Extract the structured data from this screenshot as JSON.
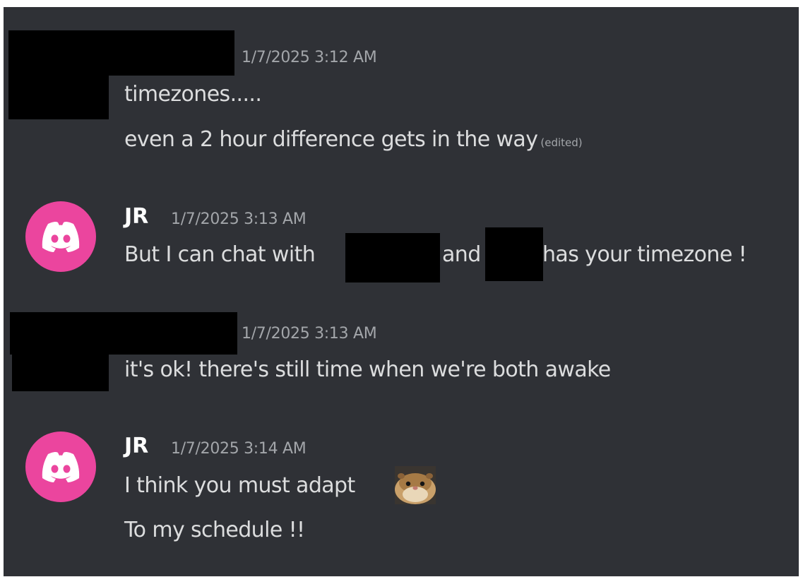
{
  "messages": [
    {
      "author": "",
      "timestamp": "1/7/2025 3:12 AM",
      "lines": [
        "timezones.....",
        "even a 2 hour difference gets in the way"
      ],
      "edited_label": "(edited)"
    },
    {
      "author": "JR",
      "timestamp": "1/7/2025 3:13 AM",
      "avatar_icon": "discord-logo-icon",
      "avatar_color": "#eb459e",
      "parts": [
        "But I can chat with",
        "and",
        "has your timezone !"
      ]
    },
    {
      "author": "",
      "timestamp": "1/7/2025 3:13 AM",
      "lines": [
        "it's ok! there's still time when we're both awake"
      ]
    },
    {
      "author": "JR",
      "timestamp": "1/7/2025 3:14 AM",
      "avatar_icon": "discord-logo-icon",
      "avatar_color": "#eb459e",
      "lines": [
        "I think you must adapt",
        "To my schedule !!"
      ],
      "emoji": "hamster-emoji-icon"
    }
  ],
  "colors": {
    "background": "#2f3136",
    "text": "#dcddde",
    "muted": "#a3a6aa",
    "avatar": "#eb459e"
  }
}
